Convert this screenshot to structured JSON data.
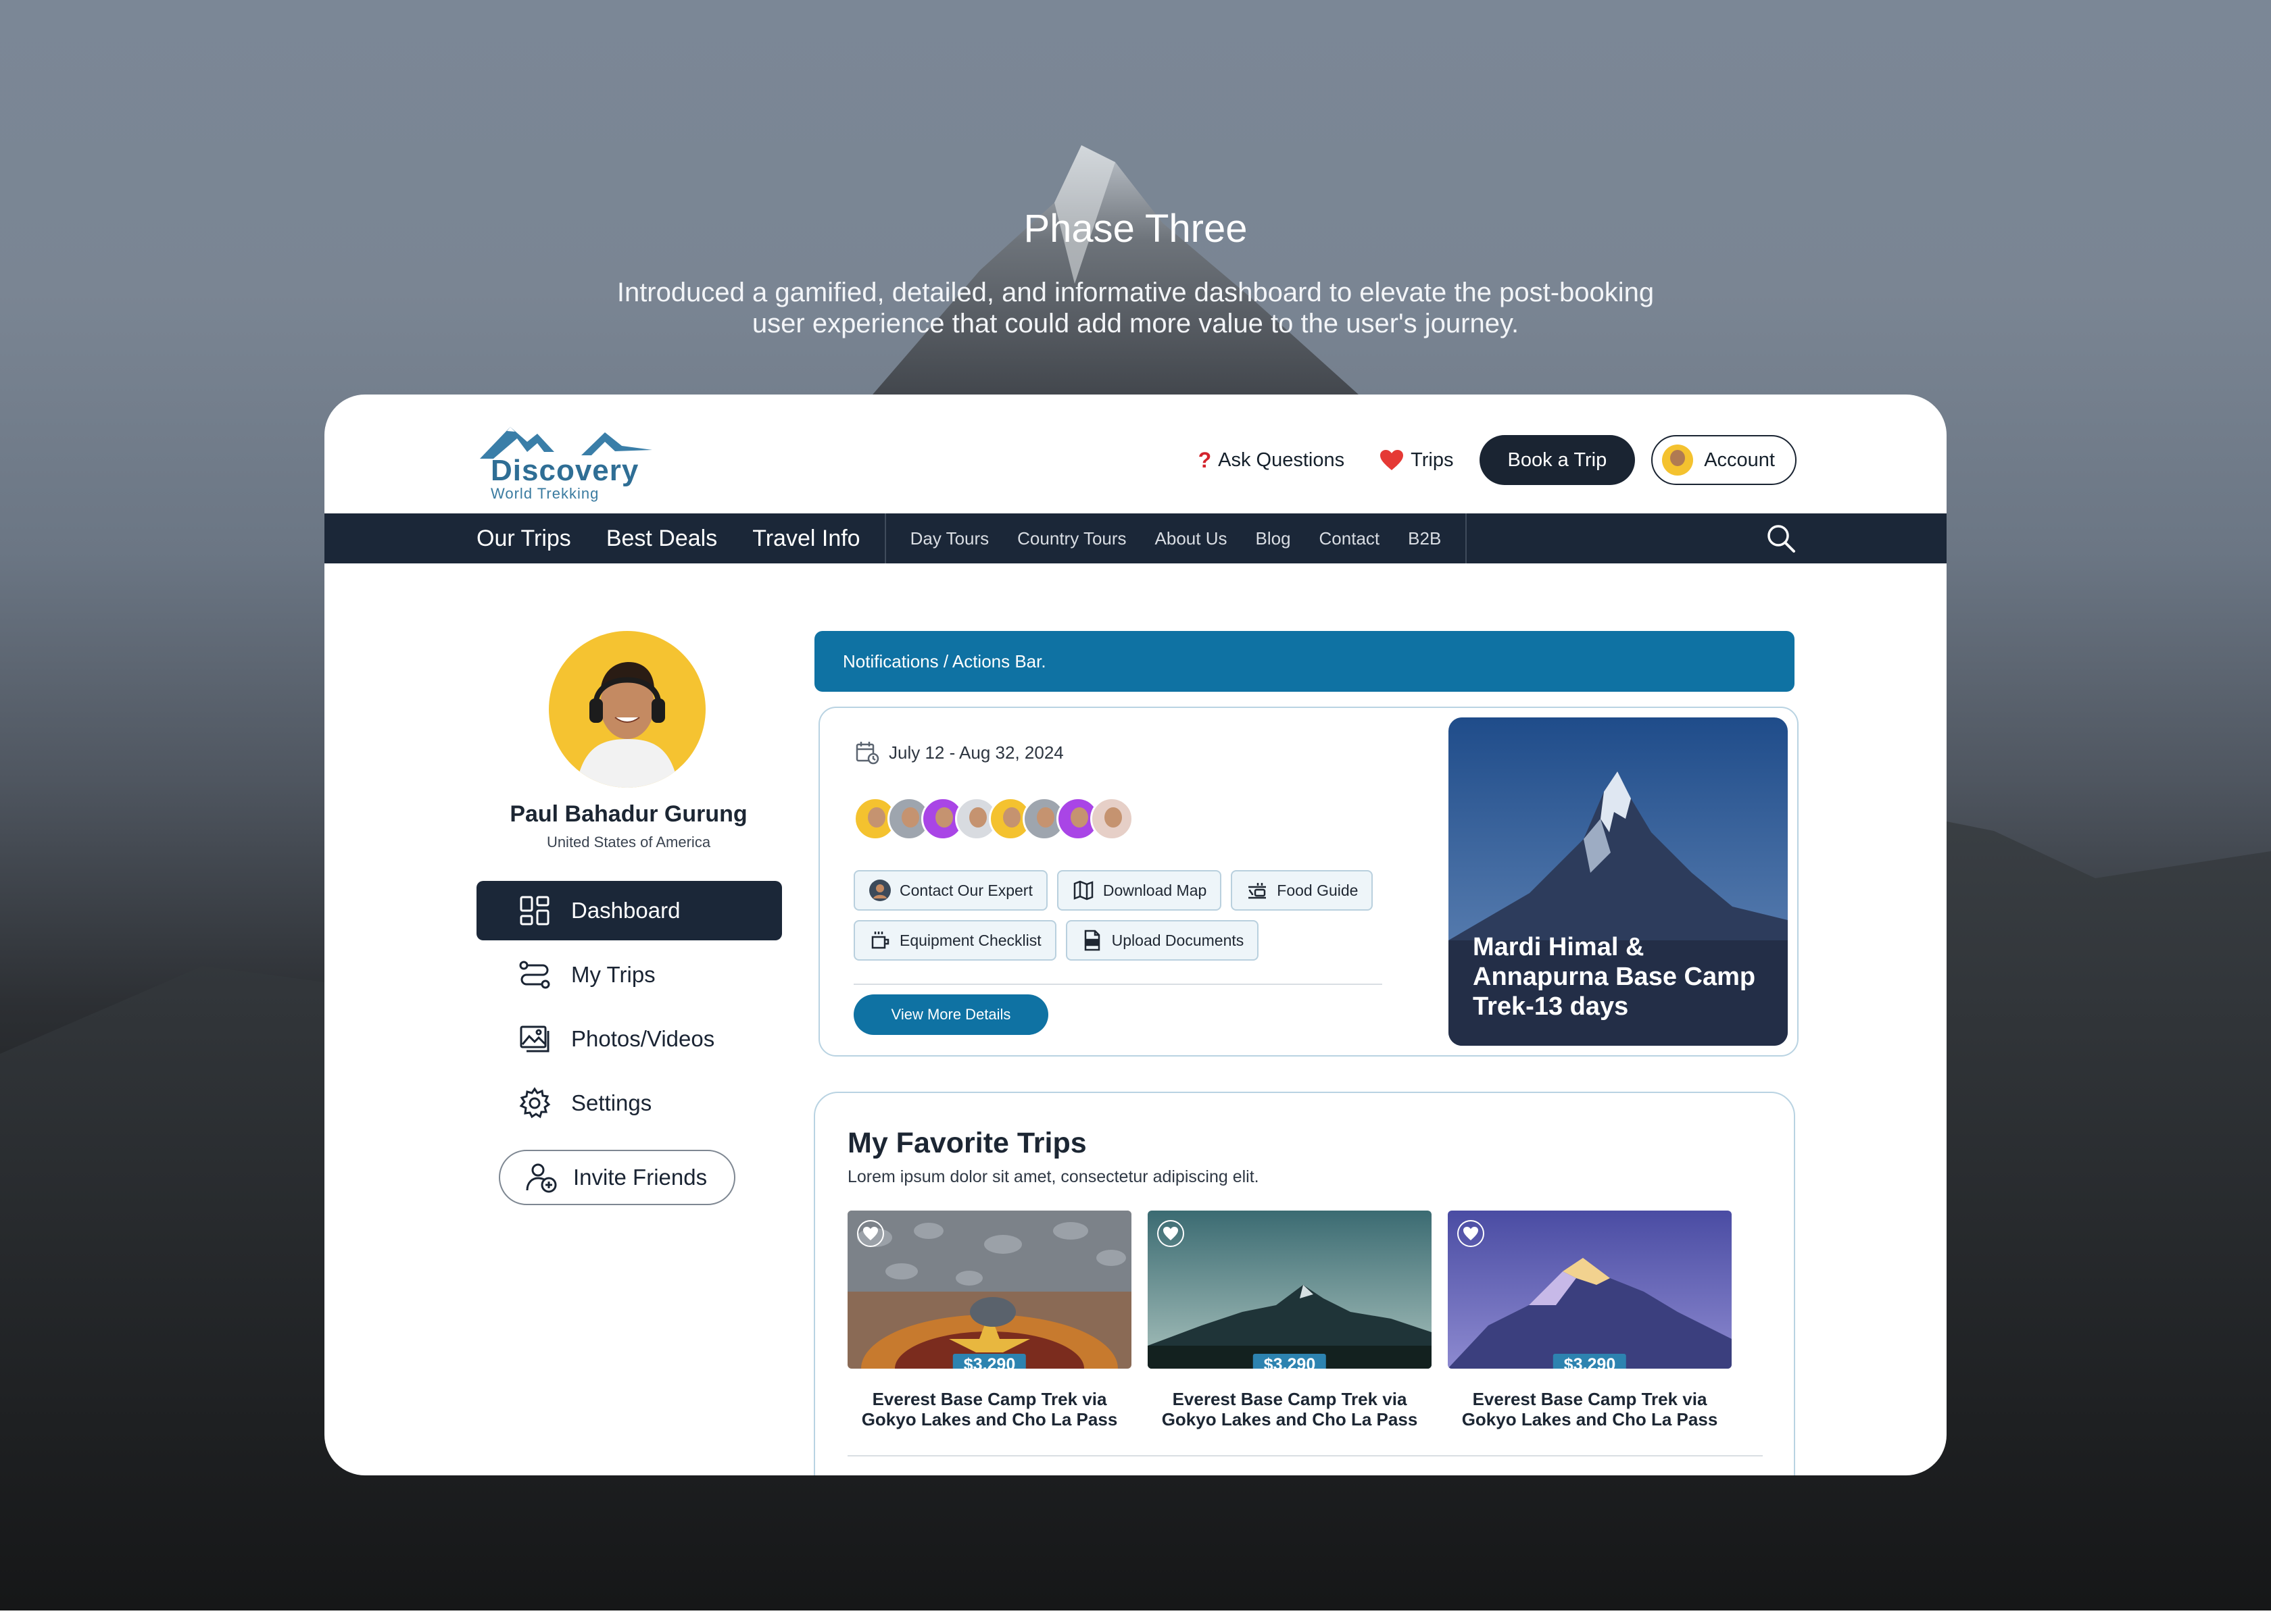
{
  "hero": {
    "title": "Phase Three",
    "subtitle": "Introduced a gamified, detailed, and informative dashboard to elevate the post-booking user experience that could add more value to the user's journey."
  },
  "header": {
    "logo_word": "Discovery",
    "logo_sub": "World Trekking",
    "ask_questions": "Ask Questions",
    "trips": "Trips",
    "book_trip": "Book a Trip",
    "account": "Account"
  },
  "nav": {
    "main": [
      "Our Trips",
      "Best Deals",
      "Travel Info"
    ],
    "secondary": [
      "Day Tours",
      "Country Tours",
      "About Us",
      "Blog",
      "Contact",
      "B2B"
    ]
  },
  "profile": {
    "name": "Paul Bahadur Gurung",
    "country": "United States of America"
  },
  "menu": [
    {
      "label": "Dashboard",
      "icon": "dashboard-icon",
      "active": true
    },
    {
      "label": "My Trips",
      "icon": "route-icon",
      "active": false
    },
    {
      "label": "Photos/Videos",
      "icon": "gallery-icon",
      "active": false
    },
    {
      "label": "Settings",
      "icon": "settings-icon",
      "active": false
    }
  ],
  "invite_label": "Invite Friends",
  "notifications_bar": "Notifications / Actions Bar.",
  "upcoming_trip": {
    "dates": "July 12 - Aug 32, 2024",
    "actions": [
      "Contact Our Expert",
      "Download Map",
      "Food Guide",
      "Equipment Checklist",
      "Upload Documents"
    ],
    "view_more": "View More Details",
    "title": "Mardi Himal & Annapurna Base Camp Trek-13 days"
  },
  "favorites": {
    "title": "My Favorite Trips",
    "subtitle": "Lorem ipsum dolor sit amet, consectetur adipiscing elit.",
    "items": [
      {
        "price": "$3,290",
        "name": "Everest Base Camp Trek via Gokyo Lakes and Cho La Pass"
      },
      {
        "price": "$3,290",
        "name": "Everest Base Camp Trek via Gokyo Lakes and Cho La Pass"
      },
      {
        "price": "$3,290",
        "name": "Everest Base Camp Trek via Gokyo Lakes and Cho La Pass"
      }
    ]
  },
  "colors": {
    "navy": "#1b2738",
    "accent_blue": "#0f72a3",
    "price_blue": "#2d83b0",
    "avatar_yellow": "#f5c331"
  }
}
